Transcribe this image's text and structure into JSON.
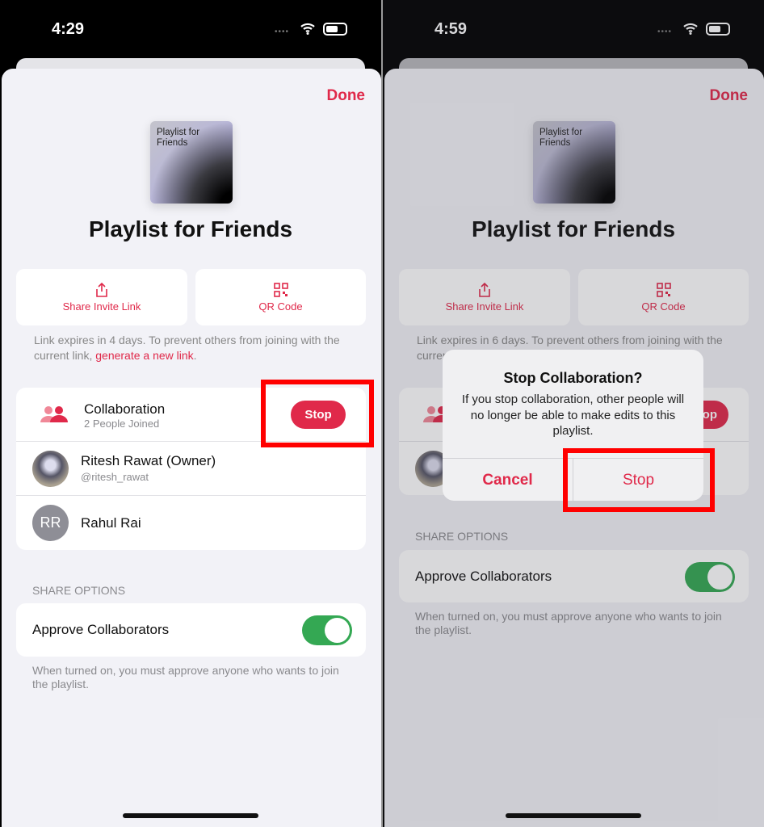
{
  "colors": {
    "accent": "#e0294a",
    "toggle_on": "#34a853",
    "highlight": "#ff0000"
  },
  "left": {
    "status": {
      "time": "4:29"
    },
    "done": "Done",
    "artwork_text": "Playlist for Friends",
    "title": "Playlist for Friends",
    "share_invite": "Share Invite Link",
    "qr_code": "QR Code",
    "expire_text": "Link expires in 4 days. To prevent others from joining with the current link, ",
    "expire_link": "generate a new link",
    "expire_end": ".",
    "collaboration": {
      "label": "Collaboration",
      "sub": "2 People Joined",
      "stop": "Stop"
    },
    "members": [
      {
        "name": "Ritesh Rawat (Owner)",
        "handle": "@ritesh_rawat"
      },
      {
        "name": "Rahul Rai",
        "initials": "RR"
      }
    ],
    "share_options": "SHARE OPTIONS",
    "approve": {
      "label": "Approve Collaborators",
      "on": true
    },
    "footer": "When turned on, you must approve anyone who wants to join the playlist."
  },
  "right": {
    "status": {
      "time": "4:59"
    },
    "done": "Done",
    "artwork_text": "Playlist for Friends",
    "title": "Playlist for Friends",
    "share_invite": "Share Invite Link",
    "qr_code": "QR Code",
    "expire_text": "Link expires in 6 days. To prevent others from joining with the current link, generate a new link.",
    "share_options": "SHARE OPTIONS",
    "approve": {
      "label": "Approve Collaborators",
      "on": true
    },
    "footer": "When turned on, you must approve anyone who wants to join the playlist.",
    "stop_partial": "op",
    "dialog": {
      "title": "Stop Collaboration?",
      "message": "If you stop collaboration, other people will no longer be able to make edits to this playlist.",
      "cancel": "Cancel",
      "stop": "Stop"
    }
  }
}
